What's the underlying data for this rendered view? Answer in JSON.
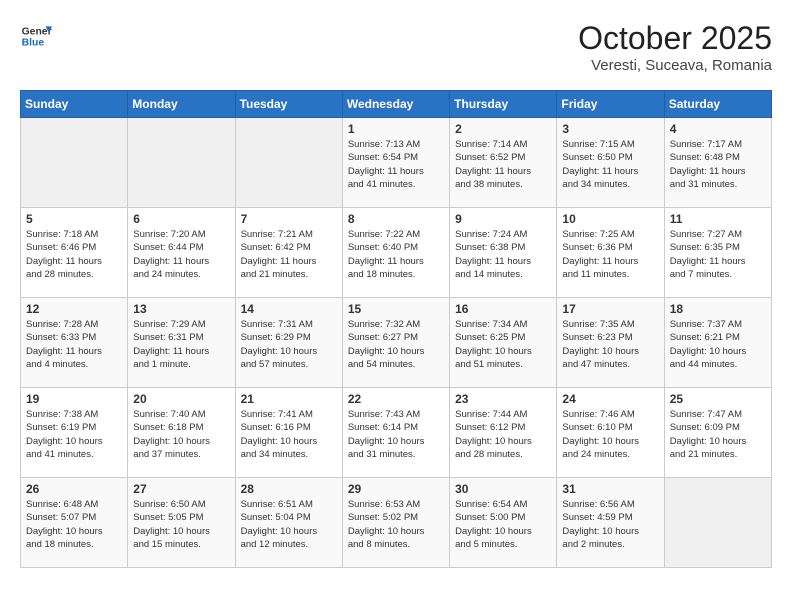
{
  "header": {
    "logo_line1": "General",
    "logo_line2": "Blue",
    "month": "October 2025",
    "location": "Veresti, Suceava, Romania"
  },
  "weekdays": [
    "Sunday",
    "Monday",
    "Tuesday",
    "Wednesday",
    "Thursday",
    "Friday",
    "Saturday"
  ],
  "weeks": [
    [
      {
        "day": "",
        "info": ""
      },
      {
        "day": "",
        "info": ""
      },
      {
        "day": "",
        "info": ""
      },
      {
        "day": "1",
        "info": "Sunrise: 7:13 AM\nSunset: 6:54 PM\nDaylight: 11 hours\nand 41 minutes."
      },
      {
        "day": "2",
        "info": "Sunrise: 7:14 AM\nSunset: 6:52 PM\nDaylight: 11 hours\nand 38 minutes."
      },
      {
        "day": "3",
        "info": "Sunrise: 7:15 AM\nSunset: 6:50 PM\nDaylight: 11 hours\nand 34 minutes."
      },
      {
        "day": "4",
        "info": "Sunrise: 7:17 AM\nSunset: 6:48 PM\nDaylight: 11 hours\nand 31 minutes."
      }
    ],
    [
      {
        "day": "5",
        "info": "Sunrise: 7:18 AM\nSunset: 6:46 PM\nDaylight: 11 hours\nand 28 minutes."
      },
      {
        "day": "6",
        "info": "Sunrise: 7:20 AM\nSunset: 6:44 PM\nDaylight: 11 hours\nand 24 minutes."
      },
      {
        "day": "7",
        "info": "Sunrise: 7:21 AM\nSunset: 6:42 PM\nDaylight: 11 hours\nand 21 minutes."
      },
      {
        "day": "8",
        "info": "Sunrise: 7:22 AM\nSunset: 6:40 PM\nDaylight: 11 hours\nand 18 minutes."
      },
      {
        "day": "9",
        "info": "Sunrise: 7:24 AM\nSunset: 6:38 PM\nDaylight: 11 hours\nand 14 minutes."
      },
      {
        "day": "10",
        "info": "Sunrise: 7:25 AM\nSunset: 6:36 PM\nDaylight: 11 hours\nand 11 minutes."
      },
      {
        "day": "11",
        "info": "Sunrise: 7:27 AM\nSunset: 6:35 PM\nDaylight: 11 hours\nand 7 minutes."
      }
    ],
    [
      {
        "day": "12",
        "info": "Sunrise: 7:28 AM\nSunset: 6:33 PM\nDaylight: 11 hours\nand 4 minutes."
      },
      {
        "day": "13",
        "info": "Sunrise: 7:29 AM\nSunset: 6:31 PM\nDaylight: 11 hours\nand 1 minute."
      },
      {
        "day": "14",
        "info": "Sunrise: 7:31 AM\nSunset: 6:29 PM\nDaylight: 10 hours\nand 57 minutes."
      },
      {
        "day": "15",
        "info": "Sunrise: 7:32 AM\nSunset: 6:27 PM\nDaylight: 10 hours\nand 54 minutes."
      },
      {
        "day": "16",
        "info": "Sunrise: 7:34 AM\nSunset: 6:25 PM\nDaylight: 10 hours\nand 51 minutes."
      },
      {
        "day": "17",
        "info": "Sunrise: 7:35 AM\nSunset: 6:23 PM\nDaylight: 10 hours\nand 47 minutes."
      },
      {
        "day": "18",
        "info": "Sunrise: 7:37 AM\nSunset: 6:21 PM\nDaylight: 10 hours\nand 44 minutes."
      }
    ],
    [
      {
        "day": "19",
        "info": "Sunrise: 7:38 AM\nSunset: 6:19 PM\nDaylight: 10 hours\nand 41 minutes."
      },
      {
        "day": "20",
        "info": "Sunrise: 7:40 AM\nSunset: 6:18 PM\nDaylight: 10 hours\nand 37 minutes."
      },
      {
        "day": "21",
        "info": "Sunrise: 7:41 AM\nSunset: 6:16 PM\nDaylight: 10 hours\nand 34 minutes."
      },
      {
        "day": "22",
        "info": "Sunrise: 7:43 AM\nSunset: 6:14 PM\nDaylight: 10 hours\nand 31 minutes."
      },
      {
        "day": "23",
        "info": "Sunrise: 7:44 AM\nSunset: 6:12 PM\nDaylight: 10 hours\nand 28 minutes."
      },
      {
        "day": "24",
        "info": "Sunrise: 7:46 AM\nSunset: 6:10 PM\nDaylight: 10 hours\nand 24 minutes."
      },
      {
        "day": "25",
        "info": "Sunrise: 7:47 AM\nSunset: 6:09 PM\nDaylight: 10 hours\nand 21 minutes."
      }
    ],
    [
      {
        "day": "26",
        "info": "Sunrise: 6:48 AM\nSunset: 5:07 PM\nDaylight: 10 hours\nand 18 minutes."
      },
      {
        "day": "27",
        "info": "Sunrise: 6:50 AM\nSunset: 5:05 PM\nDaylight: 10 hours\nand 15 minutes."
      },
      {
        "day": "28",
        "info": "Sunrise: 6:51 AM\nSunset: 5:04 PM\nDaylight: 10 hours\nand 12 minutes."
      },
      {
        "day": "29",
        "info": "Sunrise: 6:53 AM\nSunset: 5:02 PM\nDaylight: 10 hours\nand 8 minutes."
      },
      {
        "day": "30",
        "info": "Sunrise: 6:54 AM\nSunset: 5:00 PM\nDaylight: 10 hours\nand 5 minutes."
      },
      {
        "day": "31",
        "info": "Sunrise: 6:56 AM\nSunset: 4:59 PM\nDaylight: 10 hours\nand 2 minutes."
      },
      {
        "day": "",
        "info": ""
      }
    ]
  ]
}
